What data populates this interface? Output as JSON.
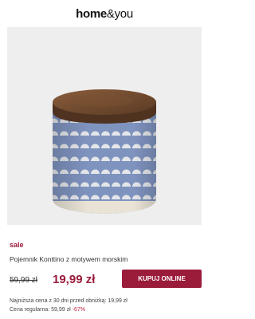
{
  "header": {
    "logo_home": "home",
    "logo_amp": "&you"
  },
  "product": {
    "badge": "sale",
    "title": "Pojemnik Konttino z motywem morskim",
    "old_price": "59,99 zł",
    "new_price": "19,99 zł",
    "buy_label": "KUPUJ ONLINE",
    "lowest_price_note": "Najniższa cena z 30 dni przed obniżką: 19,99 zł",
    "regular_price_note": "Cena regularna: 59,99 zł",
    "discount": "-67%"
  },
  "colors": {
    "accent": "#9b1b3b",
    "jar_blue": "#7f93bf",
    "lid_wood": "#6e4a2f",
    "image_bg": "#eeeeee"
  },
  "icons": {
    "product_image": "ceramic-jar-with-wooden-lid"
  }
}
